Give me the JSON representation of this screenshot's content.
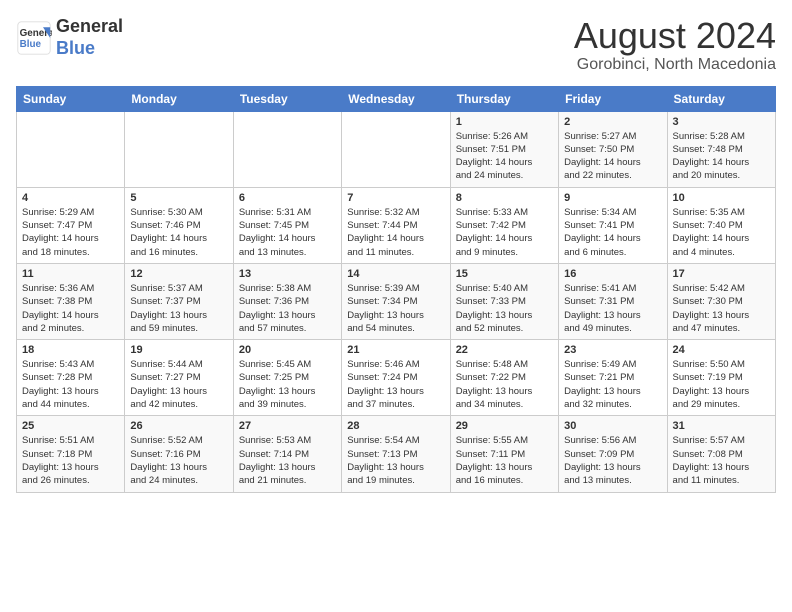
{
  "header": {
    "logo_line1": "General",
    "logo_line2": "Blue",
    "month_year": "August 2024",
    "location": "Gorobinci, North Macedonia"
  },
  "weekdays": [
    "Sunday",
    "Monday",
    "Tuesday",
    "Wednesday",
    "Thursday",
    "Friday",
    "Saturday"
  ],
  "weeks": [
    [
      {
        "day": "",
        "info": ""
      },
      {
        "day": "",
        "info": ""
      },
      {
        "day": "",
        "info": ""
      },
      {
        "day": "",
        "info": ""
      },
      {
        "day": "1",
        "info": "Sunrise: 5:26 AM\nSunset: 7:51 PM\nDaylight: 14 hours\nand 24 minutes."
      },
      {
        "day": "2",
        "info": "Sunrise: 5:27 AM\nSunset: 7:50 PM\nDaylight: 14 hours\nand 22 minutes."
      },
      {
        "day": "3",
        "info": "Sunrise: 5:28 AM\nSunset: 7:48 PM\nDaylight: 14 hours\nand 20 minutes."
      }
    ],
    [
      {
        "day": "4",
        "info": "Sunrise: 5:29 AM\nSunset: 7:47 PM\nDaylight: 14 hours\nand 18 minutes."
      },
      {
        "day": "5",
        "info": "Sunrise: 5:30 AM\nSunset: 7:46 PM\nDaylight: 14 hours\nand 16 minutes."
      },
      {
        "day": "6",
        "info": "Sunrise: 5:31 AM\nSunset: 7:45 PM\nDaylight: 14 hours\nand 13 minutes."
      },
      {
        "day": "7",
        "info": "Sunrise: 5:32 AM\nSunset: 7:44 PM\nDaylight: 14 hours\nand 11 minutes."
      },
      {
        "day": "8",
        "info": "Sunrise: 5:33 AM\nSunset: 7:42 PM\nDaylight: 14 hours\nand 9 minutes."
      },
      {
        "day": "9",
        "info": "Sunrise: 5:34 AM\nSunset: 7:41 PM\nDaylight: 14 hours\nand 6 minutes."
      },
      {
        "day": "10",
        "info": "Sunrise: 5:35 AM\nSunset: 7:40 PM\nDaylight: 14 hours\nand 4 minutes."
      }
    ],
    [
      {
        "day": "11",
        "info": "Sunrise: 5:36 AM\nSunset: 7:38 PM\nDaylight: 14 hours\nand 2 minutes."
      },
      {
        "day": "12",
        "info": "Sunrise: 5:37 AM\nSunset: 7:37 PM\nDaylight: 13 hours\nand 59 minutes."
      },
      {
        "day": "13",
        "info": "Sunrise: 5:38 AM\nSunset: 7:36 PM\nDaylight: 13 hours\nand 57 minutes."
      },
      {
        "day": "14",
        "info": "Sunrise: 5:39 AM\nSunset: 7:34 PM\nDaylight: 13 hours\nand 54 minutes."
      },
      {
        "day": "15",
        "info": "Sunrise: 5:40 AM\nSunset: 7:33 PM\nDaylight: 13 hours\nand 52 minutes."
      },
      {
        "day": "16",
        "info": "Sunrise: 5:41 AM\nSunset: 7:31 PM\nDaylight: 13 hours\nand 49 minutes."
      },
      {
        "day": "17",
        "info": "Sunrise: 5:42 AM\nSunset: 7:30 PM\nDaylight: 13 hours\nand 47 minutes."
      }
    ],
    [
      {
        "day": "18",
        "info": "Sunrise: 5:43 AM\nSunset: 7:28 PM\nDaylight: 13 hours\nand 44 minutes."
      },
      {
        "day": "19",
        "info": "Sunrise: 5:44 AM\nSunset: 7:27 PM\nDaylight: 13 hours\nand 42 minutes."
      },
      {
        "day": "20",
        "info": "Sunrise: 5:45 AM\nSunset: 7:25 PM\nDaylight: 13 hours\nand 39 minutes."
      },
      {
        "day": "21",
        "info": "Sunrise: 5:46 AM\nSunset: 7:24 PM\nDaylight: 13 hours\nand 37 minutes."
      },
      {
        "day": "22",
        "info": "Sunrise: 5:48 AM\nSunset: 7:22 PM\nDaylight: 13 hours\nand 34 minutes."
      },
      {
        "day": "23",
        "info": "Sunrise: 5:49 AM\nSunset: 7:21 PM\nDaylight: 13 hours\nand 32 minutes."
      },
      {
        "day": "24",
        "info": "Sunrise: 5:50 AM\nSunset: 7:19 PM\nDaylight: 13 hours\nand 29 minutes."
      }
    ],
    [
      {
        "day": "25",
        "info": "Sunrise: 5:51 AM\nSunset: 7:18 PM\nDaylight: 13 hours\nand 26 minutes."
      },
      {
        "day": "26",
        "info": "Sunrise: 5:52 AM\nSunset: 7:16 PM\nDaylight: 13 hours\nand 24 minutes."
      },
      {
        "day": "27",
        "info": "Sunrise: 5:53 AM\nSunset: 7:14 PM\nDaylight: 13 hours\nand 21 minutes."
      },
      {
        "day": "28",
        "info": "Sunrise: 5:54 AM\nSunset: 7:13 PM\nDaylight: 13 hours\nand 19 minutes."
      },
      {
        "day": "29",
        "info": "Sunrise: 5:55 AM\nSunset: 7:11 PM\nDaylight: 13 hours\nand 16 minutes."
      },
      {
        "day": "30",
        "info": "Sunrise: 5:56 AM\nSunset: 7:09 PM\nDaylight: 13 hours\nand 13 minutes."
      },
      {
        "day": "31",
        "info": "Sunrise: 5:57 AM\nSunset: 7:08 PM\nDaylight: 13 hours\nand 11 minutes."
      }
    ]
  ]
}
